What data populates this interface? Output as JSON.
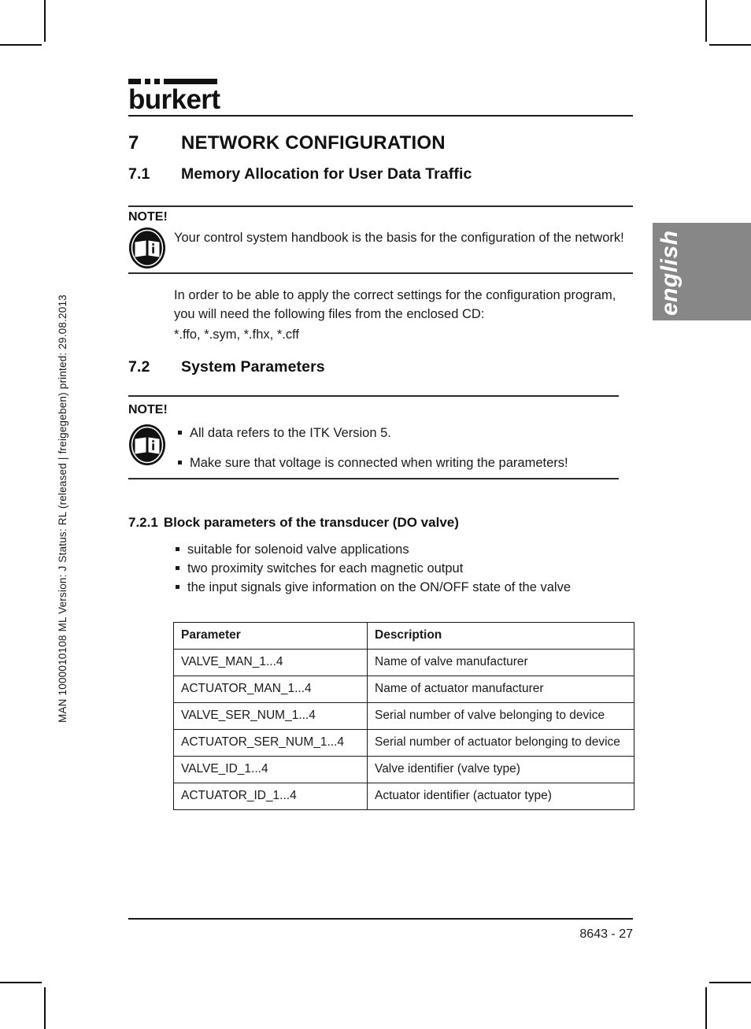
{
  "margin_note": "MAN 1000010108  ML  Version: J  Status: RL (released | freigegeben)  printed: 29.08.2013",
  "language_tab": {
    "label": "english",
    "background_color": "#878787",
    "text_color": "#ffffff"
  },
  "logo": {
    "wordmark": "burkert"
  },
  "sections": {
    "chapter": {
      "number": "7",
      "title": "NETWORK CONFIGURATION"
    },
    "s71": {
      "number": "7.1",
      "title": "Memory Allocation for User Data Traffic"
    },
    "s72": {
      "number": "7.2",
      "title": "System Parameters"
    },
    "s721": {
      "number": "7.2.1",
      "title": "Block parameters of the transducer (DO valve)"
    }
  },
  "note1": {
    "label": "NOTE!",
    "icon": "note-book-info-icon",
    "text": "Your control system handbook is the basis for the configuration of the network!"
  },
  "body1": {
    "paragraph": "In order to be able to apply the correct settings for the configuration program, you will need the following files from the enclosed CD:",
    "file_types": "*.ffo, *.sym, *.fhx, *.cff"
  },
  "note2": {
    "label": "NOTE!",
    "icon": "note-book-info-icon",
    "bullets": [
      "All data refers to the ITK Version 5.",
      "Make sure that voltage is connected when writing the parameters!"
    ]
  },
  "features": [
    "suitable for solenoid valve applications",
    "two proximity switches for each magnetic output",
    "the input signals give information on the ON/OFF state of the valve"
  ],
  "parameter_table": {
    "headers": [
      "Parameter",
      "Description"
    ],
    "rows": [
      [
        "VALVE_MAN_1...4",
        "Name of valve manufacturer"
      ],
      [
        "ACTUATOR_MAN_1...4",
        "Name of actuator manufacturer"
      ],
      [
        "VALVE_SER_NUM_1...4",
        "Serial number of valve belonging to device"
      ],
      [
        "ACTUATOR_SER_NUM_1...4",
        "Serial number of actuator belonging to device"
      ],
      [
        "VALVE_ID_1...4",
        "Valve identifier (valve type)"
      ],
      [
        "ACTUATOR_ID_1...4",
        "Actuator identifier (actuator type)"
      ]
    ]
  },
  "footer": {
    "page_reference": "8643 - 27"
  }
}
